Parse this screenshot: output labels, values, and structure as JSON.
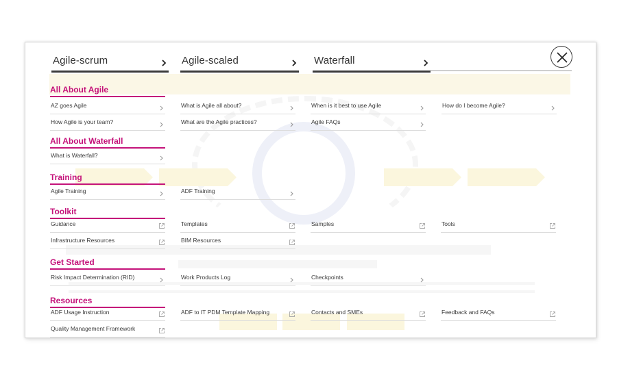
{
  "tabs": [
    {
      "label": "Agile-scrum"
    },
    {
      "label": "Agile-scaled"
    },
    {
      "label": "Waterfall"
    }
  ],
  "close_icon": "close-icon",
  "colors": {
    "accent": "#c4127a",
    "text": "#3a3a3a",
    "tab_rule": "#3a3a3a"
  },
  "sections": {
    "all_about_agile": {
      "title": "All About Agile",
      "items": [
        {
          "label": "AZ goes Agile",
          "icon": "chevron-right-icon"
        },
        {
          "label": "What is Agile all about?",
          "icon": "chevron-right-icon"
        },
        {
          "label": "When is it best to use Agile",
          "icon": "chevron-right-icon"
        },
        {
          "label": "How do I become Agile?",
          "icon": "chevron-right-icon"
        },
        {
          "label": "How Agile is your team?",
          "icon": "chevron-right-icon"
        },
        {
          "label": "What are the Agile practices?",
          "icon": "chevron-right-icon"
        },
        {
          "label": "Agile FAQs",
          "icon": "chevron-right-icon"
        }
      ]
    },
    "all_about_waterfall": {
      "title": "All About Waterfall",
      "items": [
        {
          "label": "What is Waterfall?",
          "icon": "chevron-right-icon"
        }
      ]
    },
    "training": {
      "title": "Training",
      "items": [
        {
          "label": "Agile Training",
          "icon": "chevron-right-icon"
        },
        {
          "label": "ADF Training",
          "icon": "chevron-right-icon"
        }
      ]
    },
    "toolkit": {
      "title": "Toolkit",
      "items": [
        {
          "label": "Guidance",
          "icon": "external-link-icon"
        },
        {
          "label": "Templates",
          "icon": "external-link-icon"
        },
        {
          "label": "Samples",
          "icon": "external-link-icon"
        },
        {
          "label": "Tools",
          "icon": "external-link-icon"
        },
        {
          "label": "Infrastructure Resources",
          "icon": "external-link-icon"
        },
        {
          "label": "BIM Resources",
          "icon": "external-link-icon"
        }
      ]
    },
    "get_started": {
      "title": "Get Started",
      "items": [
        {
          "label": "Risk Impact Determination (RID)",
          "icon": "chevron-right-icon"
        },
        {
          "label": "Work Products Log",
          "icon": "chevron-right-icon"
        },
        {
          "label": "Checkpoints",
          "icon": "chevron-right-icon"
        }
      ]
    },
    "resources": {
      "title": "Resources",
      "items": [
        {
          "label": "ADF Usage Instruction",
          "icon": "external-link-icon"
        },
        {
          "label": "ADF to IT PDM Template Mapping",
          "icon": "external-link-icon"
        },
        {
          "label": "Contacts and SMEs",
          "icon": "external-link-icon"
        },
        {
          "label": "Feedback and FAQs",
          "icon": "external-link-icon"
        },
        {
          "label": "Quality Management Framework",
          "icon": "external-link-icon"
        }
      ]
    }
  }
}
